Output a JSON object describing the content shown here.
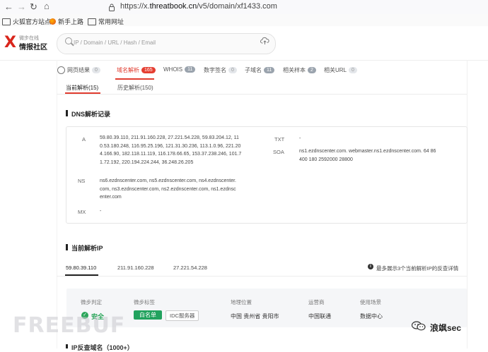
{
  "browser": {
    "back": "←",
    "forward": "→",
    "reload": "↻",
    "home": "⌂",
    "url_prefix": "https://x.",
    "url_domain": "threatbook.cn",
    "url_path": "/v5/domain/xf1433.com"
  },
  "bookmarks": [
    "火狐官方站点",
    "新手上路",
    "常用网址"
  ],
  "site": {
    "logo_mark": "X",
    "logo_small": "微步在线",
    "logo_name": "情报社区",
    "search_placeholder": "IP / Domain / URL / Hash / Email"
  },
  "tabs": [
    {
      "label": "网页结果",
      "count": "0"
    },
    {
      "label": "域名解析",
      "count": "165"
    },
    {
      "label": "WHOIS",
      "count": "11"
    },
    {
      "label": "数字签名",
      "count": "0"
    },
    {
      "label": "子域名",
      "count": "11"
    },
    {
      "label": "相关样本",
      "count": "2"
    },
    {
      "label": "相关URL",
      "count": "0"
    }
  ],
  "subtabs": [
    "当前解析(15)",
    "历史解析(150)"
  ],
  "dns": {
    "title": "DNS解析记录",
    "a_label": "A",
    "a_lines": [
      "59.80.39.110, 211.91.160.228, 27.221.54.228, 59.83.204.12, 11",
      "0.53.180.248, 116.95.25.196, 121.31.30.236, 113.1.0.96, 221.20",
      "4.166.90, 182.118.11.119, 116.178.66.65, 153.37.238.246, 101.7",
      "1.72.192, 220.194.224.244, 36.248.26.205"
    ],
    "ns_label": "NS",
    "ns_lines": [
      "ns6.ezdnscenter.com, ns5.ezdnscenter.com, ns4.ezdnscenter.",
      "com, ns3.ezdnscenter.com, ns2.ezdnscenter.com, ns1.ezdnsc",
      "enter.com"
    ],
    "mx_label": "MX",
    "mx_value": "-",
    "txt_label": "TXT",
    "txt_value": "-",
    "soa_label": "SOA",
    "soa_lines": [
      "ns1.ezdnscenter.com. webmaster.ns1.ezdnscenter.com. 64 86",
      "400 180 2592000 28800"
    ]
  },
  "current_ip": {
    "title": "当前解析IP",
    "ips": [
      "59.80.39.110",
      "211.91.160.228",
      "27.221.54.228"
    ],
    "note": "最多展示3个当前解析IP的反查详情"
  },
  "info": {
    "judge_head": "微步判定",
    "judge_value": "安全",
    "tags_head": "微步标签",
    "tag_white": "白名单",
    "tag_idc": "IDC服务器",
    "geo_head": "地理位置",
    "geo_value": "中国 贵州省 贵阳市",
    "isp_head": "运营商",
    "isp_value": "中国联通",
    "scene_head": "使用场景",
    "scene_value": "数据中心"
  },
  "watermark": {
    "freebuf": "FREEBUF",
    "author": "浪飒sec"
  },
  "bottom_partial": "IP反查域名（1000+）"
}
